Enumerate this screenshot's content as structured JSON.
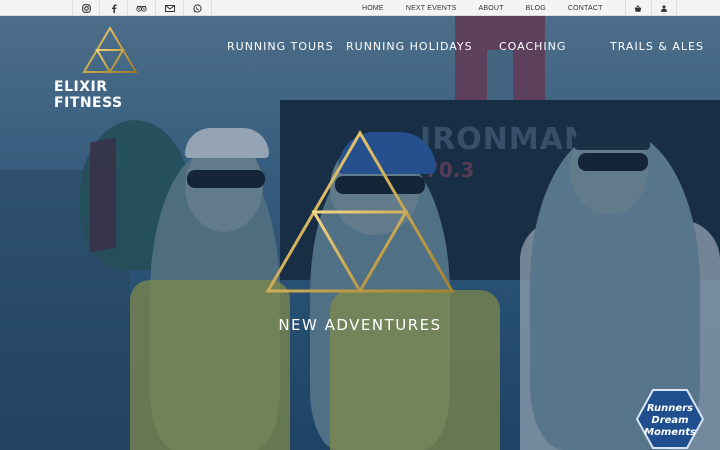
{
  "colors": {
    "accent_gold": "#c9a94a",
    "topbar_bg": "#f4f4f4",
    "badge_blue": "#1f4f8f"
  },
  "social_icons": [
    "instagram-icon",
    "facebook-icon",
    "tripadvisor-icon",
    "envelope-icon",
    "whatsapp-icon"
  ],
  "top_nav": {
    "items": [
      "HOME",
      "NEXT EVENTS",
      "ABOUT",
      "BLOG",
      "CONTACT"
    ],
    "icons": [
      "shopping-basket-icon",
      "user-icon"
    ]
  },
  "logo": {
    "text": "ELIXIR FITNESS"
  },
  "main_nav": {
    "items": [
      "RUNNING TOURS",
      "RUNNING HOLIDAYS",
      "COACHING",
      "TRAILS & ALES"
    ]
  },
  "hero": {
    "tagline": "NEW ADVENTURES"
  },
  "badge": {
    "line1": "Runners",
    "line2": "Dream",
    "line3": "Moments"
  }
}
